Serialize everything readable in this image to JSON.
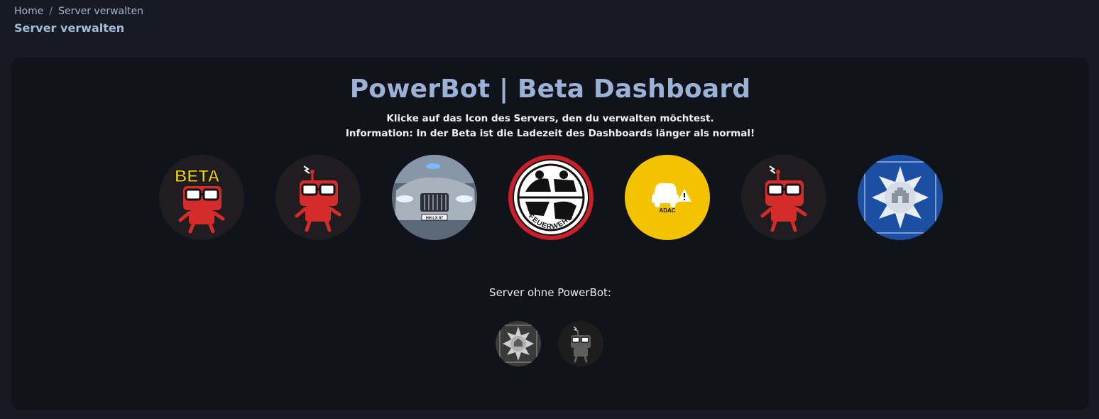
{
  "breadcrumb": {
    "home": "Home",
    "separator": "/",
    "current": "Server verwalten"
  },
  "page_title": "Server verwalten",
  "card": {
    "title": "PowerBot | Beta Dashboard",
    "instruction": "Klicke auf das Icon des Servers, den du verwalten möchtest.",
    "info": "Information: In der Beta ist die Ladezeit des Dashboards länger als normal!"
  },
  "servers": [
    {
      "icon": "powerbot-beta-mascot-icon",
      "badge_text": "BETA"
    },
    {
      "icon": "powerbot-mascot-icon"
    },
    {
      "icon": "police-car-photo-icon",
      "plate_text": "HH LX 97"
    },
    {
      "icon": "feuerwehr-emblem-icon",
      "ring_text": "FEUERWEHR"
    },
    {
      "icon": "adac-icon",
      "label": "ADAC"
    },
    {
      "icon": "powerbot-mascot-icon"
    },
    {
      "icon": "police-star-icon"
    }
  ],
  "inactive_section": {
    "label": "Server ohne PowerBot:",
    "servers": [
      {
        "icon": "police-star-icon"
      },
      {
        "icon": "powerbot-mascot-icon"
      }
    ]
  },
  "colors": {
    "background": "#171a22",
    "card": "#11131a",
    "title": "#9bb2d6",
    "accent_red": "#d42b2b",
    "adac_yellow": "#f3c300",
    "police_blue": "#1b4fa3"
  }
}
